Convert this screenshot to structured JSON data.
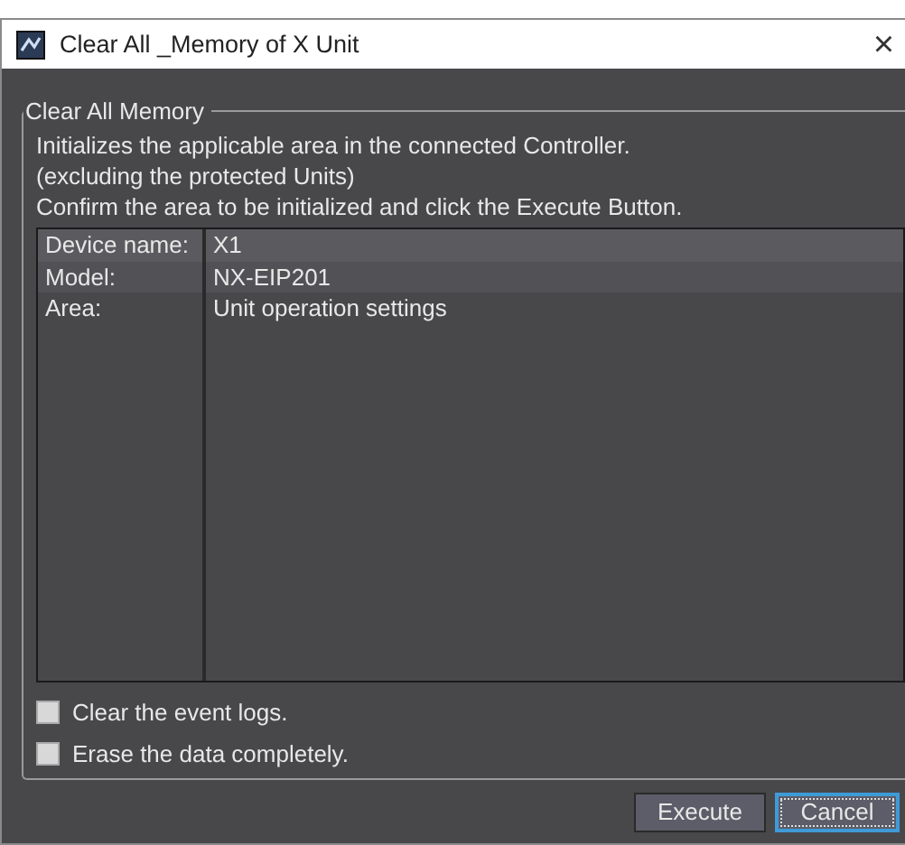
{
  "window": {
    "title": "Clear All _Memory of X Unit",
    "close": "×"
  },
  "group": {
    "title": "Clear All Memory",
    "description": [
      "Initializes the applicable area in the connected Controller.",
      "(excluding the protected Units)",
      "Confirm the area to be initialized and click the Execute Button."
    ],
    "table": {
      "rows": [
        {
          "label": "Device name:",
          "value": "X1"
        },
        {
          "label": "Model:",
          "value": "NX-EIP201"
        },
        {
          "label": "Area:",
          "value": "Unit operation settings"
        }
      ]
    },
    "options": [
      {
        "label": "Clear the event logs.",
        "checked": false
      },
      {
        "label": "Erase the data completely.",
        "checked": false
      }
    ]
  },
  "buttons": [
    {
      "label": "Execute",
      "focused": false
    },
    {
      "label": "Cancel",
      "focused": true
    }
  ]
}
